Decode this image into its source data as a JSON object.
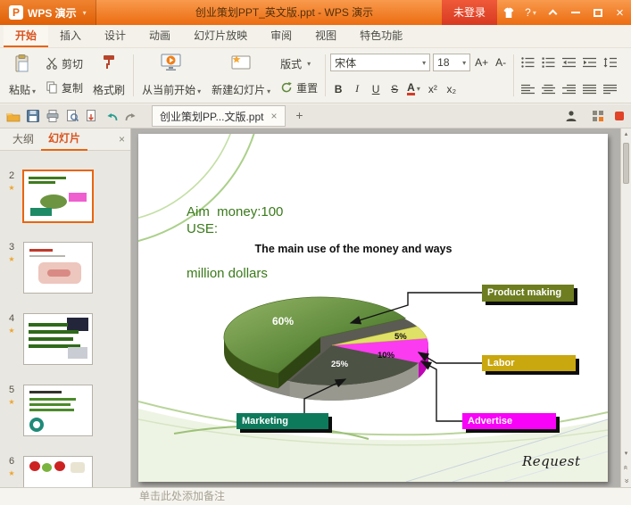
{
  "colors": {
    "accent_orange": "#e8650f",
    "titlebar_orange": "#ec6c10",
    "login_red": "#d83920",
    "pie_green": "#5f8a3c",
    "pie_yellow": "#dfe066",
    "pie_magenta": "#fb3bf0",
    "pie_dark": "#4c5244",
    "label_green": "#6e7d20",
    "label_yellow": "#c9a70e",
    "label_magenta": "#f803f8",
    "label_teal": "#0e7a5c"
  },
  "titlebar": {
    "app_name": "WPS 演示",
    "document_title": "创业策划PPT_英文版.ppt - WPS 演示",
    "login_label": "未登录",
    "help_label": "?"
  },
  "menu": {
    "tabs": [
      {
        "label": "开始"
      },
      {
        "label": "插入"
      },
      {
        "label": "设计"
      },
      {
        "label": "动画"
      },
      {
        "label": "幻灯片放映"
      },
      {
        "label": "审阅"
      },
      {
        "label": "视图"
      },
      {
        "label": "特色功能"
      }
    ]
  },
  "ribbon": {
    "paste": "粘贴",
    "cut": "剪切",
    "copy": "复制",
    "format_painter": "格式刷",
    "play_from_current": "从当前开始",
    "new_slide": "新建幻灯片",
    "layout": "版式",
    "reset": "重置",
    "font_name": "宋体",
    "font_size": "18",
    "grow_font": "A+",
    "shrink_font": "A-",
    "bold": "B",
    "italic": "I",
    "underline": "U",
    "strike": "S",
    "font_color": "A",
    "superscript": "x²",
    "subscript": "x₂"
  },
  "tabrow": {
    "document_tab": "创业策划PP...文版.ppt",
    "new_tab": "+"
  },
  "sidebar": {
    "outline_tab": "大纲",
    "slides_tab": "幻灯片",
    "slides": [
      {
        "number": "2"
      },
      {
        "number": "3"
      },
      {
        "number": "4"
      },
      {
        "number": "5"
      },
      {
        "number": "6"
      }
    ]
  },
  "slide": {
    "aim_line1": "Aim  money:100",
    "aim_line2": "million dollars",
    "use_label": "USE:",
    "heading": "The main use of the money and ways",
    "request": "Request"
  },
  "chart_data": {
    "type": "pie",
    "title": "The main use of the money and ways",
    "slices": [
      {
        "label": "Product making",
        "value": 60,
        "display": "60%"
      },
      {
        "label": "Labor",
        "value": 5,
        "display": "5%"
      },
      {
        "label": "Advertise",
        "value": 10,
        "display": "10%"
      },
      {
        "label": "Marketing",
        "value": 25,
        "display": "25%"
      }
    ],
    "legend_position": "callouts"
  },
  "notes": {
    "placeholder": "单击此处添加备注"
  }
}
